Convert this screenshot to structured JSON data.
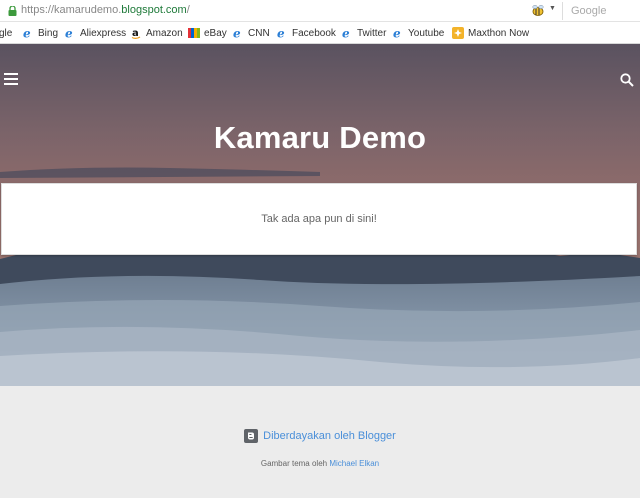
{
  "browser": {
    "url_prefix": "https://kamarudemo.",
    "url_host": "blogspot.com",
    "url_suffix": "/",
    "search_placeholder": "Google",
    "bookmarks": [
      {
        "label": "gle",
        "icon": "none"
      },
      {
        "label": "Bing",
        "icon": "ie-icon"
      },
      {
        "label": "Aliexpress",
        "icon": "ie-icon"
      },
      {
        "label": "Amazon",
        "icon": "amazon-icon"
      },
      {
        "label": "eBay",
        "icon": "ebay-icon"
      },
      {
        "label": "CNN",
        "icon": "ie-icon"
      },
      {
        "label": "Facebook",
        "icon": "ie-icon"
      },
      {
        "label": "Twitter",
        "icon": "ie-icon"
      },
      {
        "label": "Youtube",
        "icon": "ie-icon"
      },
      {
        "label": "Maxthon Now",
        "icon": "maxthon-icon"
      }
    ]
  },
  "page": {
    "blog_title": "Kamaru Demo",
    "empty_message": "Tak ada apa pun di sini!",
    "footer": {
      "powered_by": "Diberdayakan oleh Blogger",
      "credit_prefix": "Gambar tema oleh ",
      "credit_author": "Michael Elkan"
    }
  },
  "colors": {
    "link": "#4a8fd9",
    "footer_bg": "#ececec",
    "secure_host": "#1f7a3a"
  }
}
